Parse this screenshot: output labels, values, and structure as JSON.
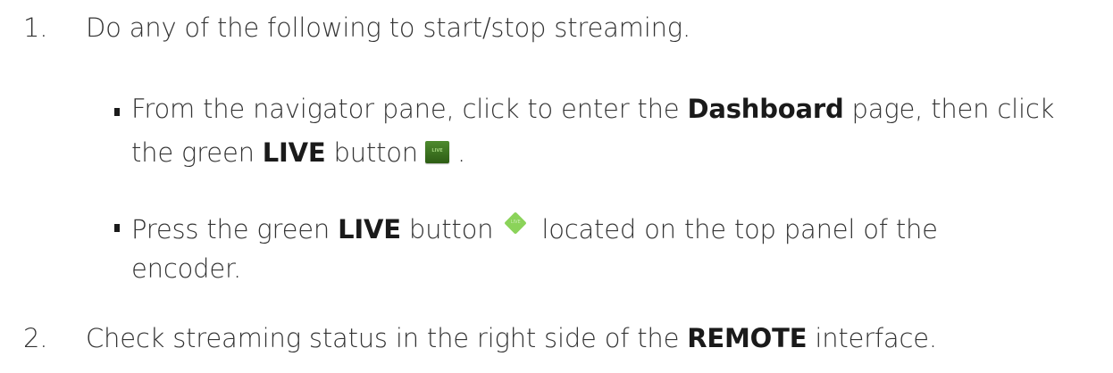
{
  "steps": [
    {
      "number": "1.",
      "text": "Do any of the following to start/stop streaming."
    },
    {
      "number": "2.",
      "text_prefix": "Check streaming status in the right side of the ",
      "bold": "REMOTE",
      "text_suffix": " interface."
    }
  ],
  "bullets": [
    {
      "line1_prefix": "From the navigator pane, click to enter the ",
      "line1_bold": "Dashboard",
      "line1_suffix": " page, then click",
      "line2_prefix": "the green ",
      "line2_bold": "LIVE",
      "line2_suffix": " button",
      "icon": "live-square-button-icon",
      "icon_text": "LIVE",
      "trailing": " ."
    },
    {
      "line1_prefix": "Press the green ",
      "line1_bold": "LIVE",
      "line1_mid": " button",
      "icon": "live-diamond-button-icon",
      "icon_text": "LIVE",
      "line1_suffix": "located on the top panel of the",
      "line2": "encoder."
    }
  ],
  "colors": {
    "text": "#333333",
    "live_square": "#2d5d14",
    "live_diamond": "#8bd35a"
  }
}
